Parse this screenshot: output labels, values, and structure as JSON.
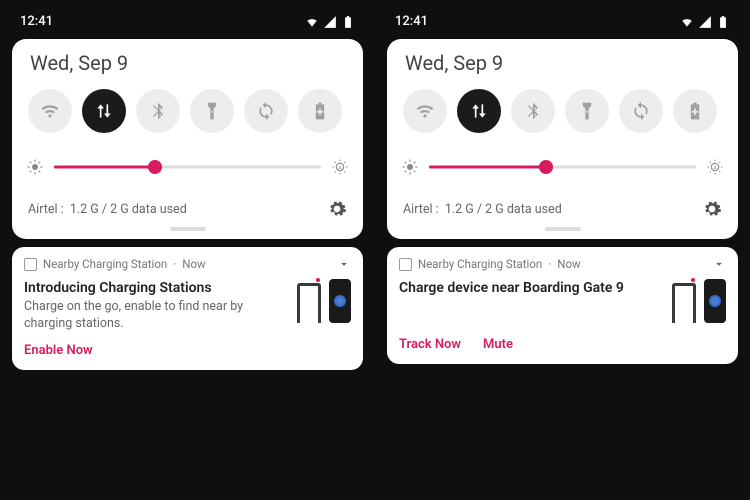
{
  "status": {
    "time": "12:41"
  },
  "left": {
    "date": "Wed, Sep 9",
    "brightness_pct": 38,
    "data_usage": "Airtel :  1.2 G / 2 G data used",
    "notif": {
      "app": "Nearby Charging Station",
      "when": "Now",
      "title": "Introducing Charging Stations",
      "body": "Charge on the go, enable to find near by charging stations.",
      "actions": [
        "Enable Now"
      ]
    }
  },
  "right": {
    "date": "Wed, Sep 9",
    "brightness_pct": 44,
    "data_usage": "Airtel :  1.2 G / 2 G data used",
    "notif": {
      "app": "Nearby Charging Station",
      "when": "Now",
      "title": "Charge device near Boarding Gate 9",
      "body": "",
      "actions": [
        "Track Now",
        "Mute"
      ]
    }
  },
  "qs_icons": [
    "wifi",
    "data",
    "bluetooth",
    "flashlight",
    "auto-rotate",
    "battery-saver"
  ]
}
